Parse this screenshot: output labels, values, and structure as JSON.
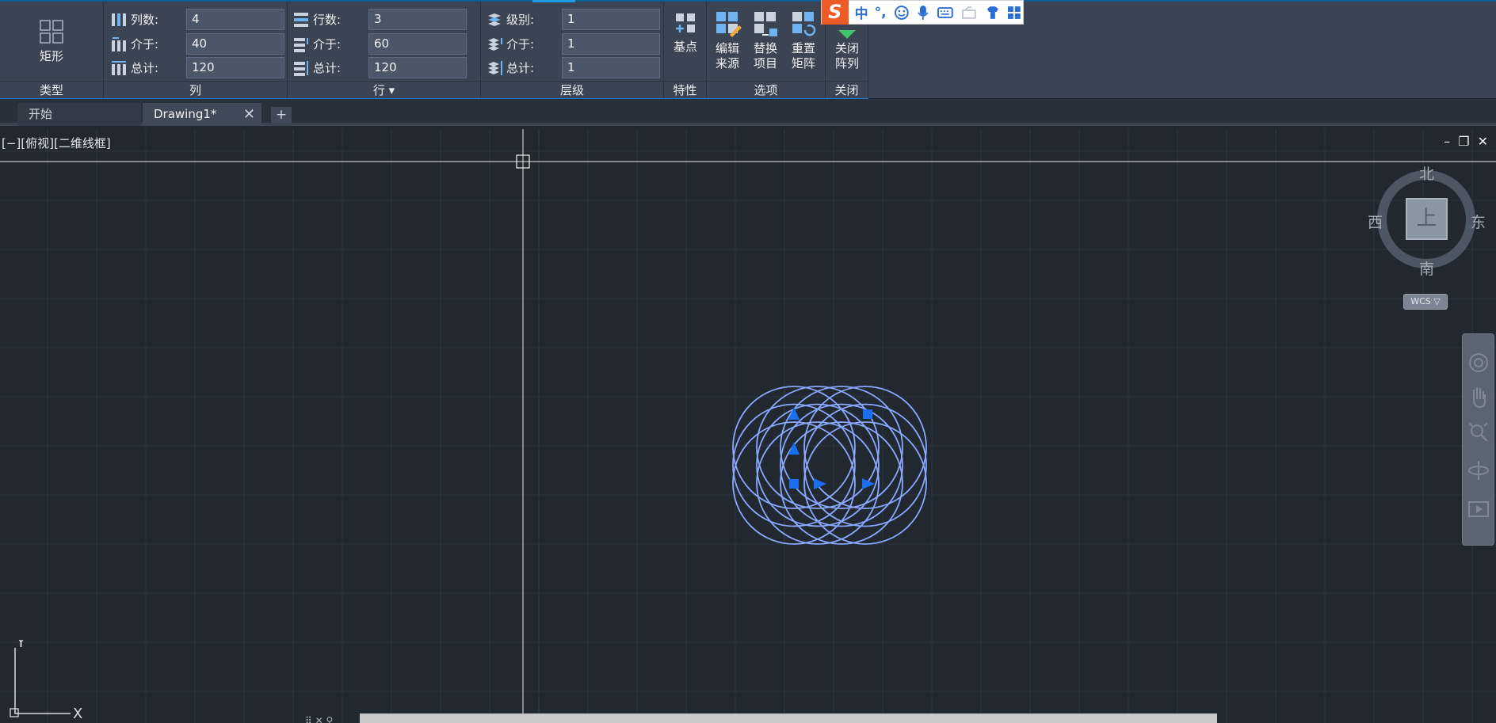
{
  "ribbon": {
    "type_panel": {
      "button_label": "矩形",
      "title": "类型"
    },
    "columns_panel": {
      "title": "列",
      "fields": [
        {
          "label": "列数:",
          "value": "4"
        },
        {
          "label": "介于:",
          "value": "40"
        },
        {
          "label": "总计:",
          "value": "120"
        }
      ]
    },
    "rows_panel": {
      "title": "行",
      "title_arrow": "▾",
      "fields": [
        {
          "label": "行数:",
          "value": "3"
        },
        {
          "label": "介于:",
          "value": "60"
        },
        {
          "label": "总计:",
          "value": "120"
        }
      ]
    },
    "levels_panel": {
      "title": "层级",
      "fields": [
        {
          "label": "级别:",
          "value": "1"
        },
        {
          "label": "介于:",
          "value": "1"
        },
        {
          "label": "总计:",
          "value": "1"
        }
      ]
    },
    "properties_panel": {
      "title": "特性",
      "base_point_label": "基点"
    },
    "options_panel": {
      "title": "选项",
      "edit_source_l1": "编辑",
      "edit_source_l2": "来源",
      "replace_item_l1": "替换",
      "replace_item_l2": "项目",
      "reset_array_l1": "重置",
      "reset_array_l2": "矩阵"
    },
    "close_panel": {
      "title": "关闭",
      "close_array_l1": "关闭",
      "close_array_l2": "阵列"
    }
  },
  "ime": {
    "logo": "S",
    "mode": "中",
    "punct": "°,",
    "items": [
      "emoji-icon",
      "mic-icon",
      "keyboard-icon",
      "toolbox-icon",
      "skin-icon",
      "grid-icon"
    ]
  },
  "tabs": {
    "start": "开始",
    "drawing": "Drawing1*",
    "close": "✕",
    "add": "+"
  },
  "viewport": {
    "label": "[−][俯视][二维线框]",
    "controls": [
      "–",
      "❐",
      "✕"
    ]
  },
  "viewcube": {
    "north": "北",
    "south": "南",
    "east": "东",
    "west": "西",
    "top": "上",
    "wcs": "WCS ▽"
  },
  "ucs": {
    "x": "X",
    "y": "Y"
  },
  "array": {
    "rows": 3,
    "columns": 4,
    "column_spacing": 40,
    "row_spacing": 60
  },
  "colors": {
    "selection": "#8aa8ff",
    "grip": "#1a6ff0",
    "accent": "#1e7bd0"
  }
}
